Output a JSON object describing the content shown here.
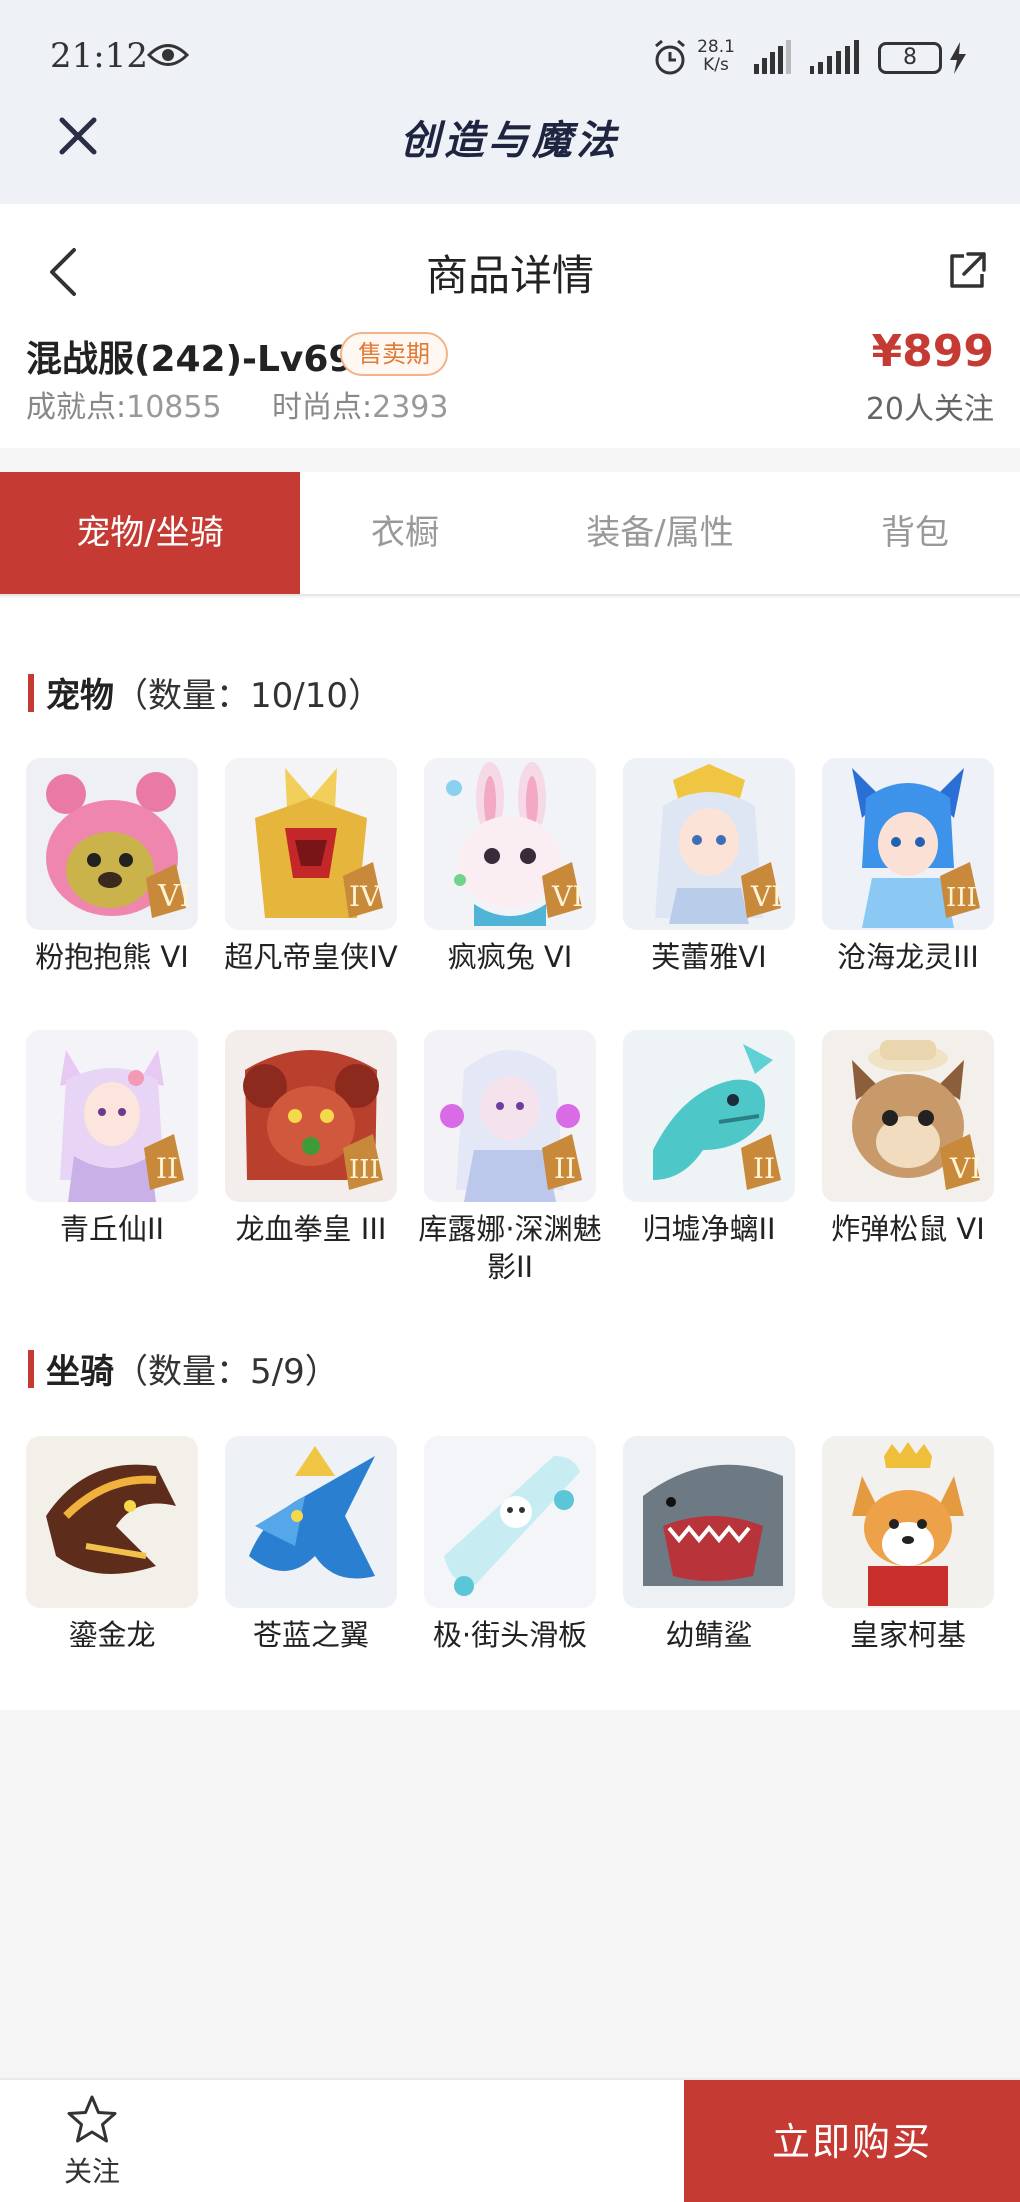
{
  "status_bar": {
    "time": "21:12",
    "net_speed_value": "28.1",
    "net_speed_unit": "K/s",
    "battery": "8"
  },
  "app": {
    "title": "创造与魔法"
  },
  "page": {
    "title": "商品详情"
  },
  "product": {
    "name": "混战服(242)-Lv69",
    "status": "售卖期",
    "price": "¥899",
    "achievement_label": "成就点:",
    "achievement_value": "10855",
    "fashion_label": "时尚点:",
    "fashion_value": "2393",
    "followers": "20人关注"
  },
  "tabs": [
    {
      "label": "宠物/坐骑",
      "active": true
    },
    {
      "label": "衣橱",
      "active": false
    },
    {
      "label": "装备/属性",
      "active": false
    },
    {
      "label": "背包",
      "active": false
    }
  ],
  "pets": {
    "title": "宠物",
    "count": "（数量：10/10）",
    "items": [
      {
        "name": "粉抱抱熊 VI",
        "rank": "VI",
        "icon": "pink-bear-icon"
      },
      {
        "name": "超凡帝皇侠IV",
        "rank": "IV",
        "icon": "gold-armor-icon"
      },
      {
        "name": "疯疯兔 VI",
        "rank": "VI",
        "icon": "bunny-icon"
      },
      {
        "name": "芙蕾雅VI",
        "rank": "VI",
        "icon": "freya-icon"
      },
      {
        "name": "沧海龙灵III",
        "rank": "III",
        "icon": "dragon-spirit-icon"
      },
      {
        "name": "青丘仙II",
        "rank": "II",
        "icon": "fox-fairy-icon"
      },
      {
        "name": "龙血拳皇 III",
        "rank": "III",
        "icon": "red-beast-icon"
      },
      {
        "name": "库露娜·深渊魅影II",
        "rank": "II",
        "icon": "abyss-ghost-icon"
      },
      {
        "name": "归墟净螭II",
        "rank": "II",
        "icon": "sea-dragon-icon"
      },
      {
        "name": "炸弹松鼠 VI",
        "rank": "VI",
        "icon": "squirrel-icon"
      }
    ]
  },
  "mounts": {
    "title": "坐骑",
    "count": "（数量：5/9）",
    "items": [
      {
        "name": "鎏金龙",
        "icon": "golden-dragon-icon"
      },
      {
        "name": "苍蓝之翼",
        "icon": "azure-wing-icon"
      },
      {
        "name": "极·街头滑板",
        "icon": "skateboard-icon"
      },
      {
        "name": "幼鲭鲨",
        "icon": "shark-icon"
      },
      {
        "name": "皇家柯基",
        "icon": "corgi-icon"
      }
    ]
  },
  "bottom": {
    "follow_label": "关注",
    "buy_label": "立即购买"
  },
  "colors": {
    "accent": "#c53a33",
    "badge_text": "#e07a34",
    "header_bg": "#eef2f7"
  }
}
